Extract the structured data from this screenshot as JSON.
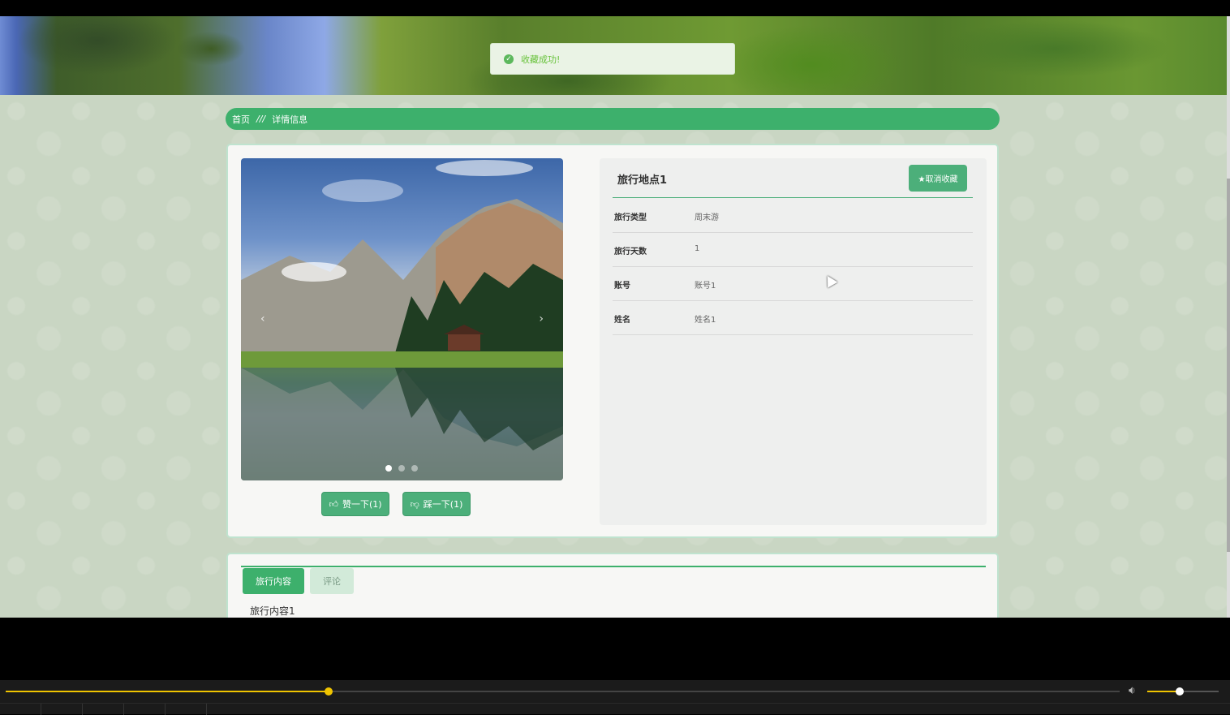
{
  "toast": {
    "message": "收藏成功!",
    "icon": "check-circle-icon"
  },
  "banner": {
    "slide_count": 3,
    "active_slide": 3
  },
  "breadcrumb": {
    "home": "首页",
    "separator": "///",
    "current": "详情信息"
  },
  "detail": {
    "title": "旅行地点1",
    "favorite_button": "★取消收藏",
    "rows": [
      {
        "label": "旅行类型",
        "value": "周末游"
      },
      {
        "label": "旅行天数",
        "value": "1"
      },
      {
        "label": "账号",
        "value": "账号1"
      },
      {
        "label": "姓名",
        "value": "姓名1"
      }
    ]
  },
  "gallery": {
    "prev": "‹",
    "next": "›",
    "slide_count": 3,
    "active_slide": 1
  },
  "votes": {
    "like_label": "赞一下(1)",
    "dislike_label": "踩一下(1)",
    "like_icon": "thumbs-up-icon",
    "dislike_icon": "thumbs-down-icon"
  },
  "tabs": [
    {
      "label": "旅行内容",
      "active": true
    },
    {
      "label": "评论",
      "active": false
    }
  ],
  "content": {
    "text": "旅行内容1"
  },
  "player": {
    "progress": 0.29,
    "volume": 0.45
  },
  "colors": {
    "accent": "#3db06c",
    "toast_text": "#67c23a",
    "player_accent": "#f0c400"
  }
}
